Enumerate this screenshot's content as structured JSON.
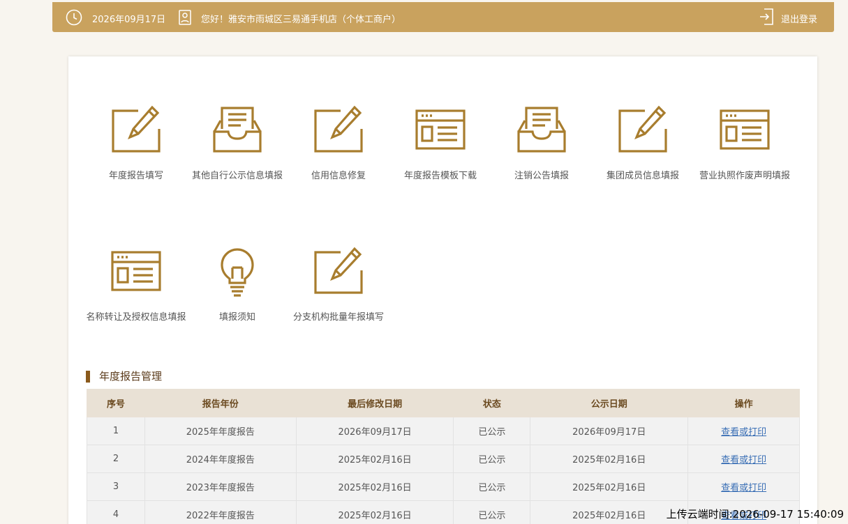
{
  "topbar": {
    "date": "2026年09月17日",
    "greeting": "您好！雅安市雨城区三易通手机店（个体工商户）",
    "logout_label": "退出登录"
  },
  "colors": {
    "accent": "#c9a25e",
    "icon": "#a87d2e",
    "header_bg": "#e9e1d5"
  },
  "tiles": [
    {
      "label": "年度报告填写",
      "icon": "edit-icon"
    },
    {
      "label": "其他自行公示信息填报",
      "icon": "inbox-icon"
    },
    {
      "label": "信用信息修复",
      "icon": "edit-icon"
    },
    {
      "label": "年度报告模板下载",
      "icon": "window-icon"
    },
    {
      "label": "注销公告填报",
      "icon": "inbox-icon"
    },
    {
      "label": "集团成员信息填报",
      "icon": "edit-icon"
    },
    {
      "label": "营业执照作废声明填报",
      "icon": "window-icon"
    },
    {
      "label": "名称转让及授权信息填报",
      "icon": "window-icon"
    },
    {
      "label": "填报须知",
      "icon": "lightbulb-icon"
    },
    {
      "label": "分支机构批量年报填写",
      "icon": "edit-icon"
    }
  ],
  "section": {
    "title": "年度报告管理"
  },
  "table": {
    "headers": [
      "序号",
      "报告年份",
      "最后修改日期",
      "状态",
      "公示日期",
      "操作"
    ],
    "rows": [
      [
        "1",
        "2025年年度报告",
        "2026年09月17日",
        "已公示",
        "2026年09月17日",
        "查看或打印"
      ],
      [
        "2",
        "2024年年度报告",
        "2025年02月16日",
        "已公示",
        "2025年02月16日",
        "查看或打印"
      ],
      [
        "3",
        "2023年年度报告",
        "2025年02月16日",
        "已公示",
        "2025年02月16日",
        "查看或打印"
      ],
      [
        "4",
        "2022年年度报告",
        "2025年02月16日",
        "已公示",
        "2025年02月16日",
        "查看或打印"
      ]
    ]
  },
  "watermark": "上传云端时间:2026-09-17 15:40:09"
}
